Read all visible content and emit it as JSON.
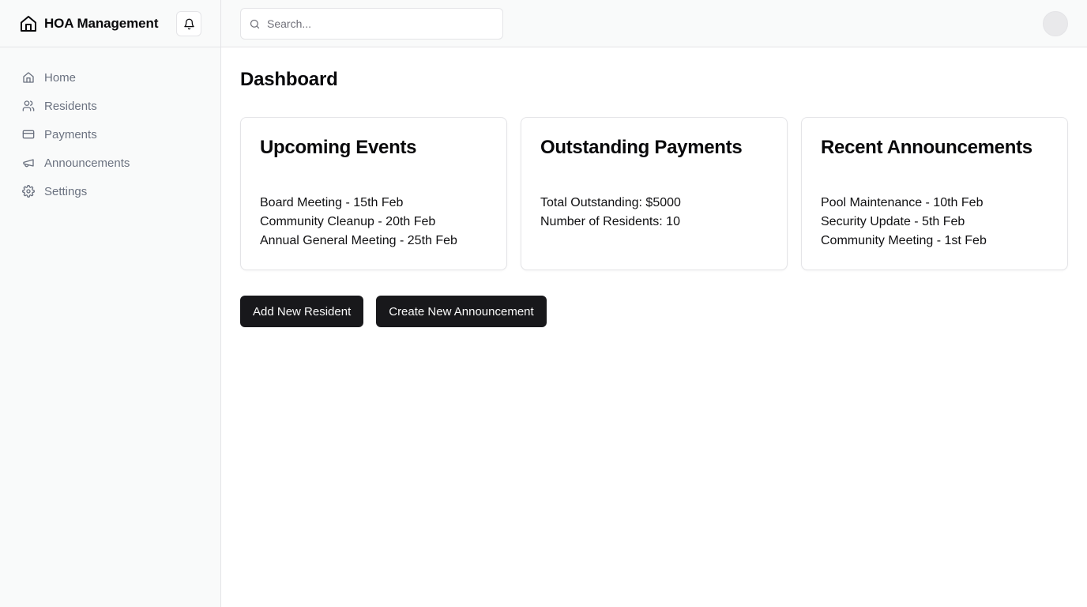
{
  "app": {
    "title": "HOA Management"
  },
  "search": {
    "placeholder": "Search..."
  },
  "sidebar": {
    "items": [
      {
        "label": "Home",
        "icon": "home-icon"
      },
      {
        "label": "Residents",
        "icon": "users-icon"
      },
      {
        "label": "Payments",
        "icon": "credit-card-icon"
      },
      {
        "label": "Announcements",
        "icon": "megaphone-icon"
      },
      {
        "label": "Settings",
        "icon": "gear-icon"
      }
    ]
  },
  "main": {
    "title": "Dashboard",
    "cards": [
      {
        "title": "Upcoming Events",
        "lines": [
          "Board Meeting - 15th Feb",
          "Community Cleanup - 20th Feb",
          "Annual General Meeting - 25th Feb"
        ]
      },
      {
        "title": "Outstanding Payments",
        "lines": [
          "Total Outstanding: $5000",
          "Number of Residents: 10"
        ]
      },
      {
        "title": "Recent Announcements",
        "lines": [
          "Pool Maintenance - 10th Feb",
          "Security Update - 5th Feb",
          "Community Meeting - 1st Feb"
        ]
      }
    ],
    "actions": {
      "add_resident": "Add New Resident",
      "create_announcement": "Create New Announcement"
    }
  },
  "colors": {
    "primary": "#18181b",
    "muted_text": "#6b7280",
    "border": "#e4e4e7",
    "sidebar_bg": "#f9fafa"
  }
}
